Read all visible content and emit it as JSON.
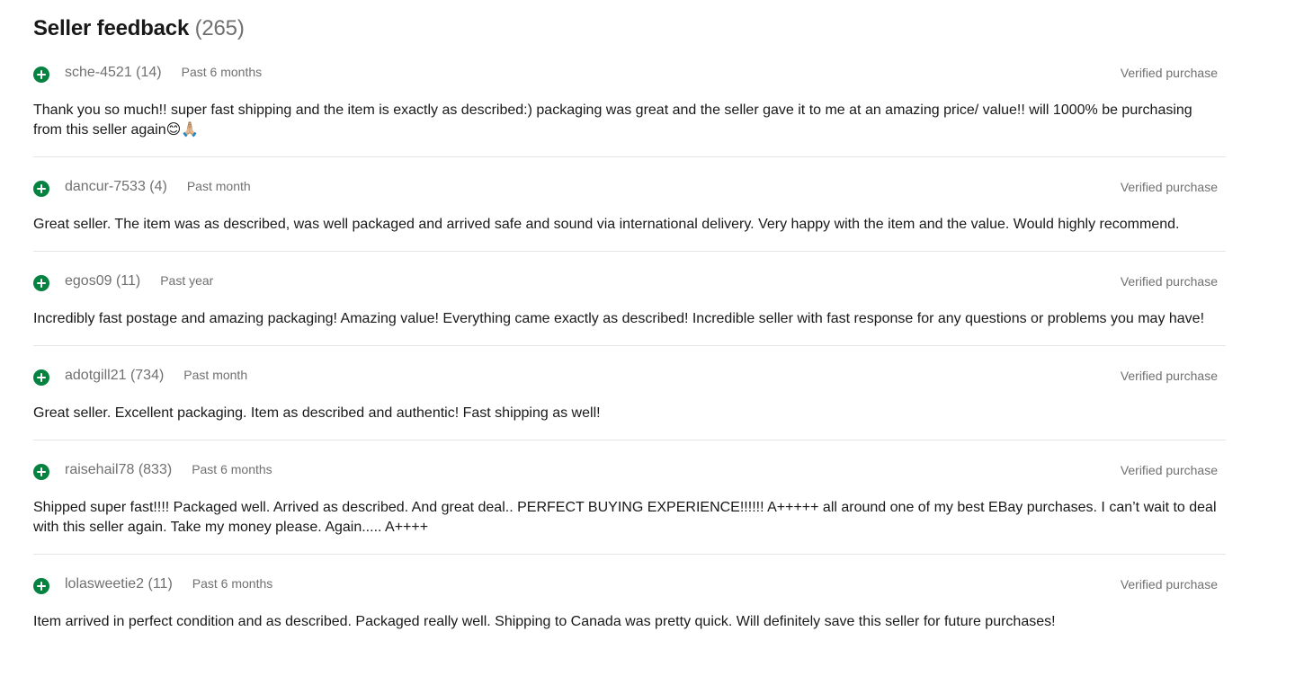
{
  "header": {
    "title": "Seller feedback",
    "count": "(265)"
  },
  "feedback": [
    {
      "icon": "positive-feedback-icon",
      "user": "sche-4521 (14)",
      "time": "Past 6 months",
      "verified": "Verified purchase",
      "comment": "Thank you so much!! super fast shipping and the item is exactly as described:) packaging was great and the seller gave it to me at an amazing price/ value!! will 1000% be purchasing from this seller again😊🙏🏼"
    },
    {
      "icon": "positive-feedback-icon",
      "user": "dancur-7533 (4)",
      "time": "Past month",
      "verified": "Verified purchase",
      "comment": "Great seller. The item was as described, was well packaged and arrived safe and sound via international delivery. Very happy with the item and the value. Would highly recommend."
    },
    {
      "icon": "positive-feedback-icon",
      "user": "egos09 (11)",
      "time": "Past year",
      "verified": "Verified purchase",
      "comment": "Incredibly fast postage and amazing packaging! Amazing value! Everything came exactly as described! Incredible seller with fast response for any questions or problems you may have!"
    },
    {
      "icon": "positive-feedback-icon",
      "user": "adotgill21 (734)",
      "time": "Past month",
      "verified": "Verified purchase",
      "comment": "Great seller. Excellent packaging. Item as described and authentic! Fast shipping as well!"
    },
    {
      "icon": "positive-feedback-icon",
      "user": "raisehail78 (833)",
      "time": "Past 6 months",
      "verified": "Verified purchase",
      "comment": "Shipped super fast!!!! Packaged well. Arrived as described. And great deal.. PERFECT BUYING EXPERIENCE!!!!!! A+++++ all around one of my best EBay purchases. I can’t wait to deal with this seller again. Take my money please. Again..... A++++"
    },
    {
      "icon": "positive-feedback-icon",
      "user": "lolasweetie2 (11)",
      "time": "Past 6 months",
      "verified": "Verified purchase",
      "comment": "Item arrived in perfect condition and as described. Packaged really well. Shipping to Canada was pretty quick. Will definitely save this seller for future purchases!"
    }
  ],
  "colors": {
    "positive": "#05823f",
    "muted_text": "#707070",
    "body_text": "#191919",
    "divider": "#e5e5e5"
  }
}
